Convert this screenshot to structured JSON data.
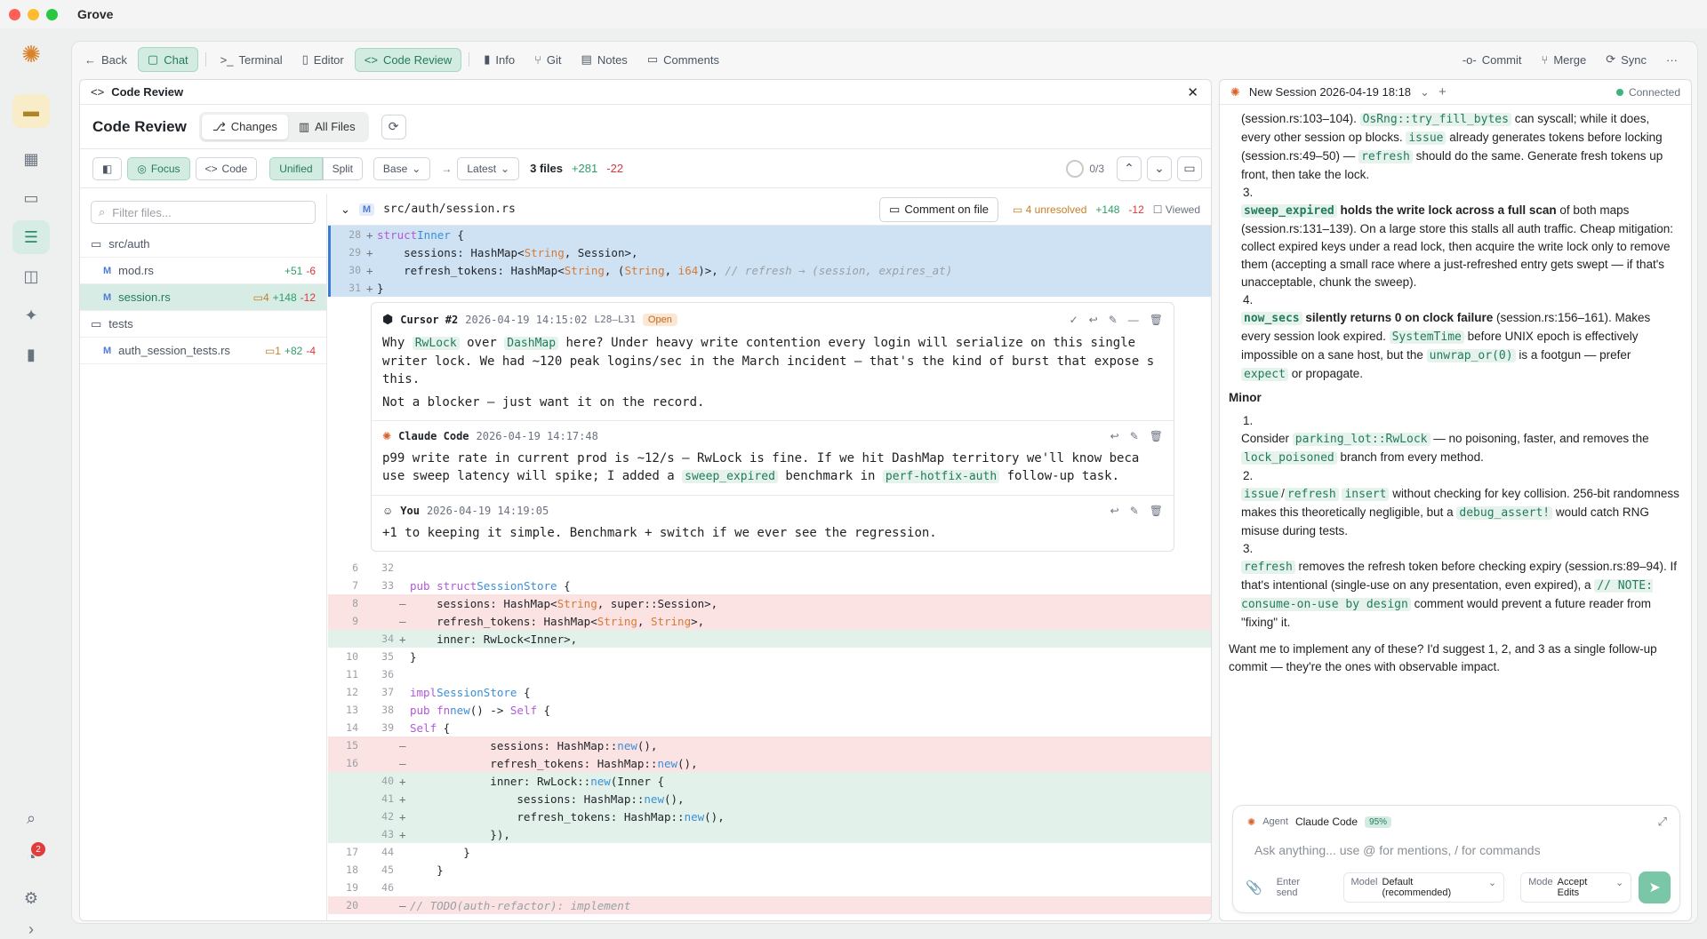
{
  "app": {
    "title": "Grove",
    "notification_count": "2"
  },
  "nav": {
    "back": "Back",
    "chat": "Chat",
    "terminal": "Terminal",
    "editor": "Editor",
    "code_review": "Code Review",
    "info": "Info",
    "git": "Git",
    "notes": "Notes",
    "comments": "Comments",
    "commit": "Commit",
    "merge": "Merge",
    "sync": "Sync"
  },
  "review": {
    "pane_title": "Code Review",
    "title": "Code Review",
    "changes": "Changes",
    "all_files": "All Files",
    "focus": "Focus",
    "code": "Code",
    "unified": "Unified",
    "split": "Split",
    "base": "Base",
    "latest": "Latest",
    "files_count": "3 files",
    "adds": "+281",
    "dels": "-22",
    "progress": "0/3",
    "filter_placeholder": "Filter files...",
    "tree": [
      {
        "type": "folder",
        "name": "src/auth"
      },
      {
        "type": "file",
        "tag": "M",
        "name": "mod.rs",
        "add": "+51",
        "del": "-6",
        "comments": ""
      },
      {
        "type": "file",
        "tag": "M",
        "name": "session.rs",
        "add": "+148",
        "del": "-12",
        "comments": "4",
        "selected": true
      },
      {
        "type": "folder",
        "name": "tests"
      },
      {
        "type": "file",
        "tag": "M",
        "name": "auth_session_tests.rs",
        "add": "+82",
        "del": "-4",
        "comments": "1"
      }
    ],
    "file": {
      "tag": "M",
      "path": "src/auth/session.rs",
      "comment_btn": "Comment on file",
      "unresolved": "4 unresolved",
      "add": "+148",
      "del": "-12",
      "viewed": "Viewed"
    }
  },
  "thread": [
    {
      "author": "Cursor #2",
      "time": "2026-04-19 14:15:02",
      "range": "L28–L31",
      "status": "Open",
      "body1a": "Why ",
      "chip1": "RwLock",
      "body1b": " over ",
      "chip2": "DashMap",
      "body1c": " here? Under heavy write contention every login will serialize on this single writer lock. We had ~120 peak logins/sec in the March incident — that's the kind of burst that expose s this.",
      "body2": "Not a blocker — just want it on the record."
    },
    {
      "author": "Claude Code",
      "time": "2026-04-19 14:17:48",
      "body1a": "p99 write rate in current prod is ~12/s — RwLock is fine. If we hit DashMap territory we'll know beca use sweep latency will spike; I added a ",
      "chip1": "sweep_expired",
      "body1b": " benchmark in ",
      "chip2": "perf-hotfix-auth",
      "body1c": " follow-up task."
    },
    {
      "author": "You",
      "time": "2026-04-19 14:19:05",
      "body1a": "+1 to keeping it simple. Benchmark + switch if we ever see the regression."
    }
  ],
  "chat": {
    "session": "New Session 2026-04-19 18:18",
    "status": "Connected",
    "agent_label": "Agent",
    "agent": "Claude Code",
    "agent_pct": "95%",
    "placeholder": "Ask anything... use @ for mentions, / for commands",
    "enter_send": "Enter send",
    "model_label": "Model",
    "model": "Default (recommended)",
    "mode_label": "Mode",
    "mode": "Accept Edits",
    "minor_heading": "Minor",
    "closing": "Want me to implement any of these? I'd suggest 1, 2, and 3 as a single follow-up commit — they're the ones with observable impact."
  }
}
